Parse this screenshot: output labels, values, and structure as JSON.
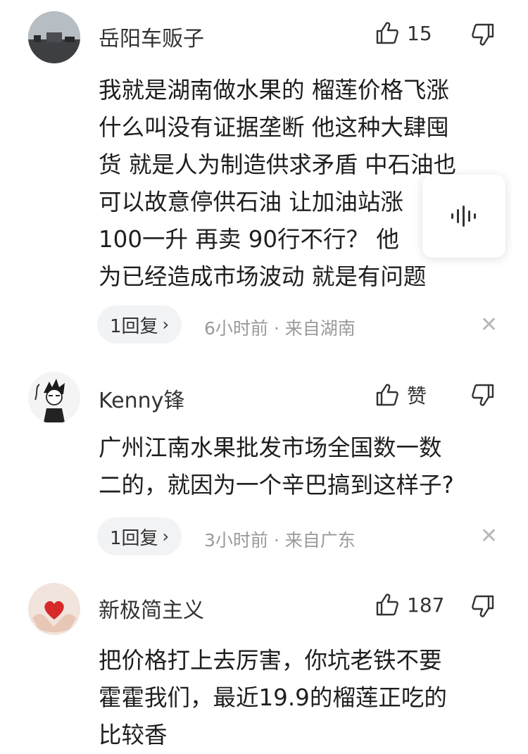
{
  "comments": [
    {
      "username": "岳阳车贩子",
      "likes": "15",
      "text": "我就是湖南做水果的 榴莲价格飞涨\n什么叫没有证据垄断 他这种大肆囤\n货 就是人为制造供求矛盾 中石油也\n可以故意停供石油 让加油站涨\n100一升 再卖 90行不行？ 他\n为已经造成市场波动 就是有问题",
      "reply_label": "1回复",
      "meta": "6小时前 · 来自湖南",
      "avatar_icon": "landscape-photo-avatar"
    },
    {
      "username": "Kenny锋",
      "likes": "赞",
      "text": "广州江南水果批发市场全国数一数\n二的，就因为一个辛巴搞到这样子?",
      "reply_label": "1回复",
      "meta": "3小时前 · 来自广东",
      "avatar_icon": "anime-character-avatar"
    },
    {
      "username": "新极简主义",
      "likes": "187",
      "text": "把价格打上去厉害，你坑老铁不要\n霍霍我们，最近19.9的榴莲正吃的\n比较香",
      "avatar_icon": "heart-in-hands-avatar"
    }
  ],
  "icons": {
    "like": "thumbs-up-icon",
    "dislike": "thumbs-down-icon",
    "close": "close-icon",
    "voice": "voice-wave-icon",
    "chevron": "chevron-right-icon"
  },
  "colors": {
    "text": "#1e1e1e",
    "meta": "#9a9a9a",
    "pill_bg": "#f2f3f5",
    "close": "#b8b8b8"
  }
}
